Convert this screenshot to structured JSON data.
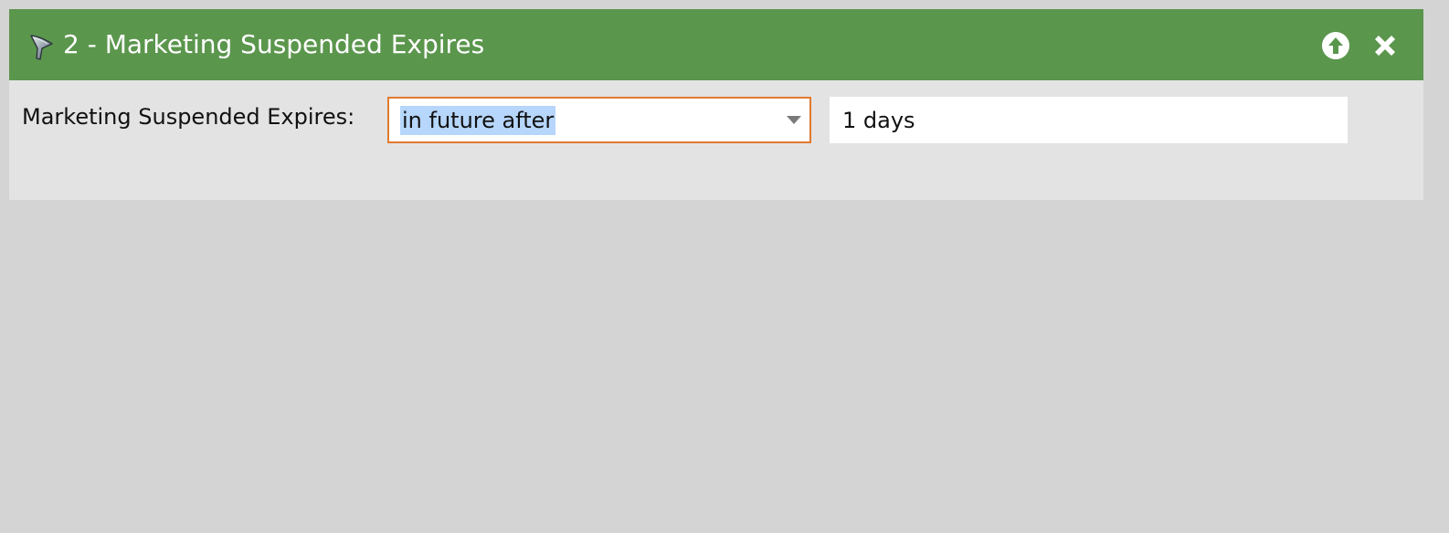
{
  "panel": {
    "title": "2 - Marketing Suspended Expires",
    "header_color": "#5b964d",
    "icons": [
      "filter-funnel-icon",
      "move-up-icon",
      "close-icon"
    ]
  },
  "filter": {
    "label": "Marketing Suspended Expires:",
    "operator": {
      "selected": "in future after",
      "focus_border_color": "#e07a2e"
    },
    "value": "1 days"
  }
}
